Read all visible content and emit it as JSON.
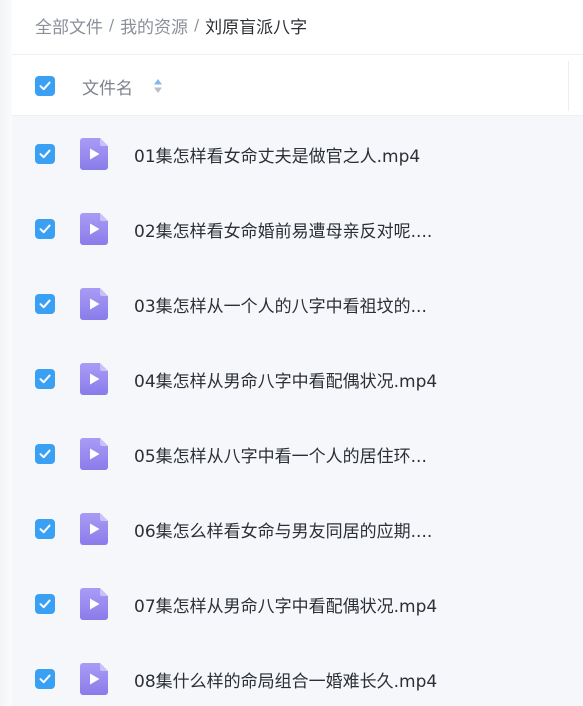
{
  "breadcrumb": {
    "items": [
      "全部文件",
      "我的资源"
    ],
    "separator": "/",
    "current": "刘原盲派八字"
  },
  "header": {
    "name_column": "文件名",
    "select_all_checked": true
  },
  "files": [
    {
      "name": "01集怎样看女命丈夫是做官之人.mp4",
      "checked": true,
      "icon": "video-file-icon"
    },
    {
      "name": "02集怎样看女命婚前易遭母亲反对呢....",
      "checked": true,
      "icon": "video-file-icon"
    },
    {
      "name": "03集怎样从一个人的八字中看祖坟的...",
      "checked": true,
      "icon": "video-file-icon"
    },
    {
      "name": "04集怎样从男命八字中看配偶状况.mp4",
      "checked": true,
      "icon": "video-file-icon"
    },
    {
      "name": "05集怎样从八字中看一个人的居住环...",
      "checked": true,
      "icon": "video-file-icon"
    },
    {
      "name": "06集怎么样看女命与男友同居的应期....",
      "checked": true,
      "icon": "video-file-icon"
    },
    {
      "name": "07集怎样从男命八字中看配偶状况.mp4",
      "checked": true,
      "icon": "video-file-icon"
    },
    {
      "name": "08集什么样的命局组合一婚难长久.mp4",
      "checked": true,
      "icon": "video-file-icon"
    }
  ],
  "colors": {
    "accent": "#3aa0f3",
    "file_icon_top": "#a99cf5",
    "file_icon_bottom": "#8a7bea"
  }
}
